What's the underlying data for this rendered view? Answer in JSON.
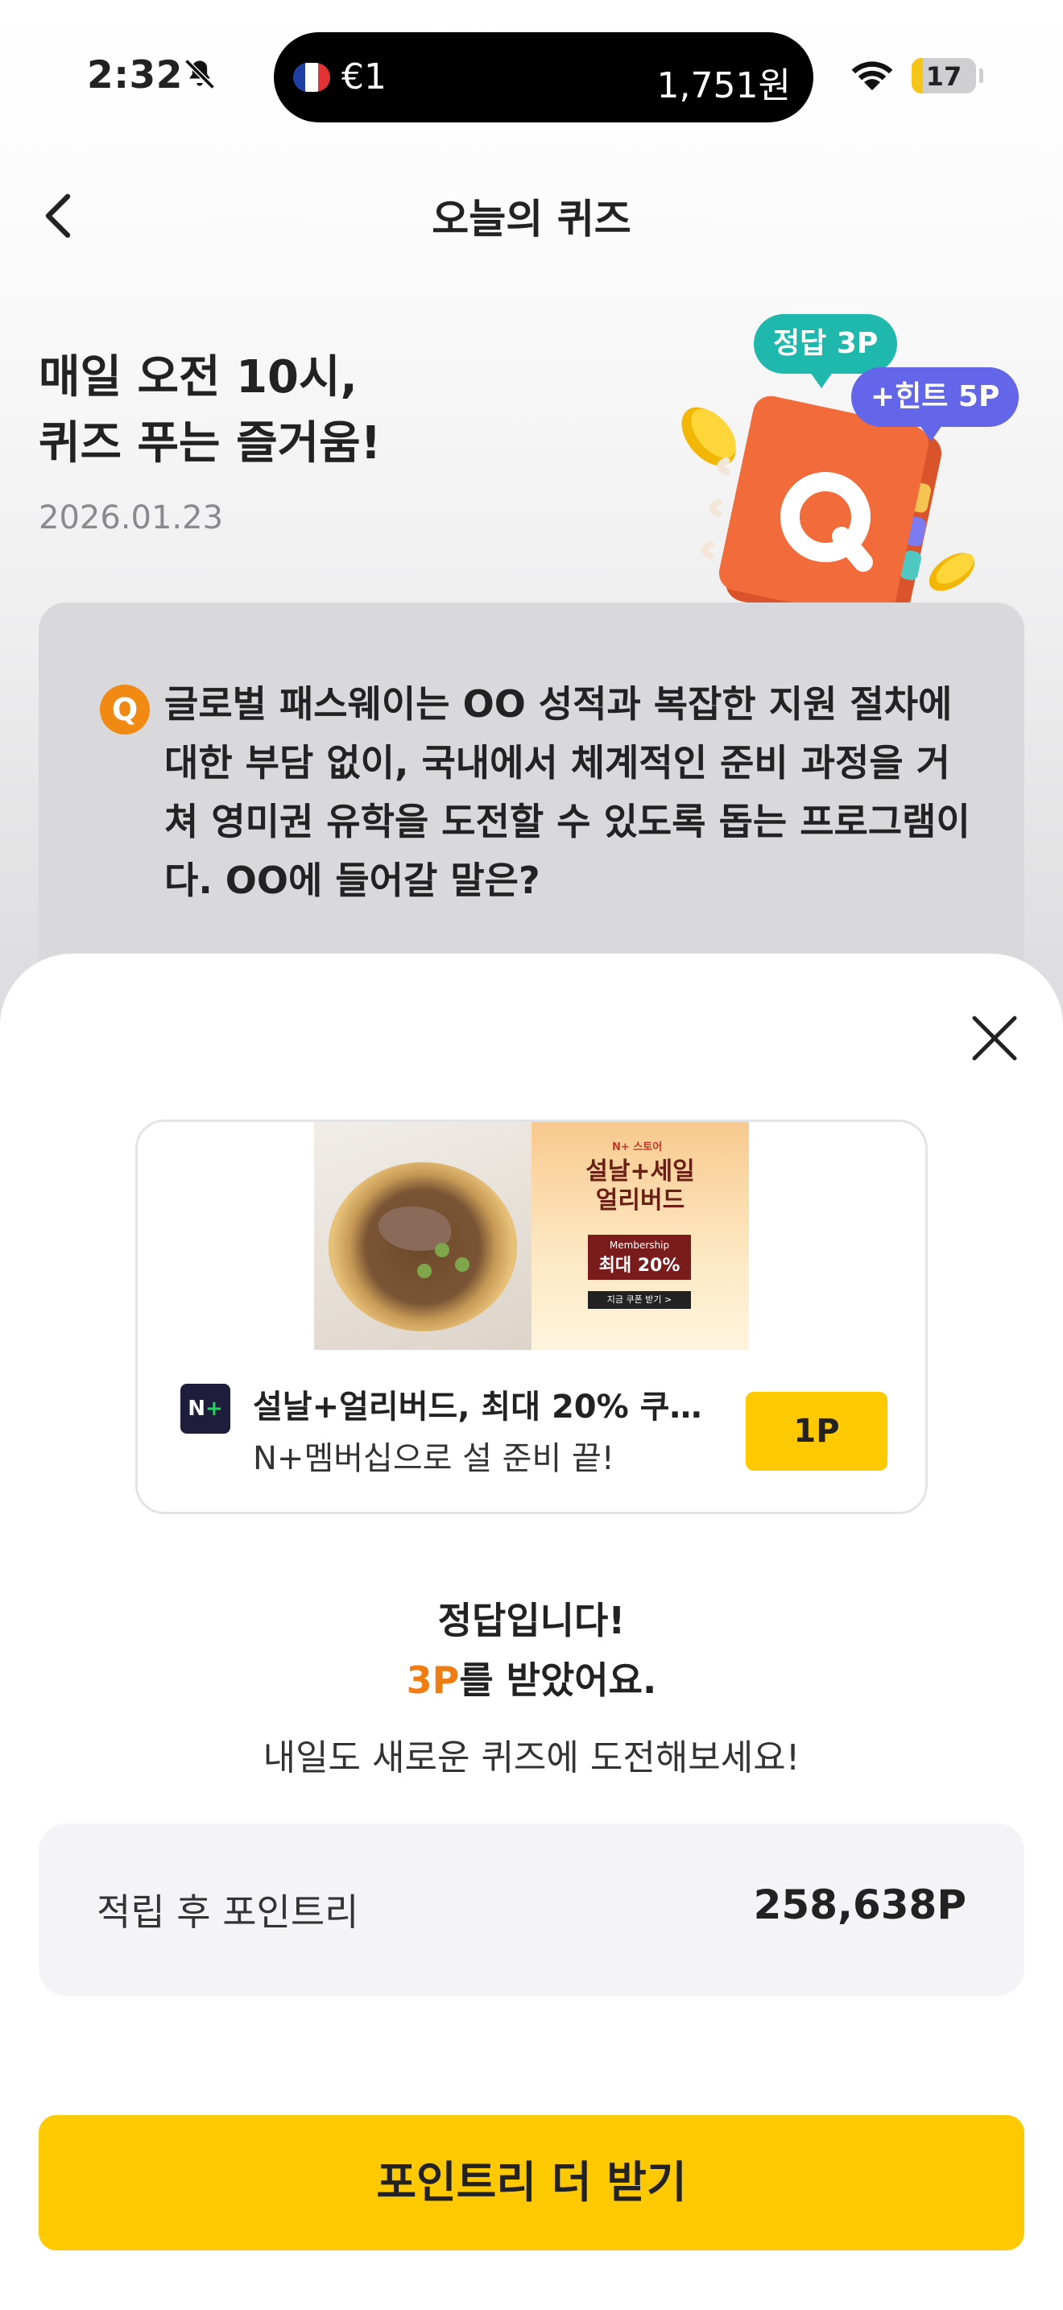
{
  "status_bar": {
    "time": "2:32",
    "island_left": "€1",
    "island_right": "1,751원",
    "battery": "17",
    "icons": [
      "bell-slash-icon",
      "france-flag-icon",
      "wifi-icon",
      "battery-icon"
    ]
  },
  "nav": {
    "title": "오늘의 퀴즈",
    "back_icon": "chevron-left-icon"
  },
  "hero": {
    "title_line1": "매일 오전 10시,",
    "title_line2": "퀴즈 푸는 즐거움!",
    "date": "2026.01.23",
    "bubble_answer": "정답 3P",
    "bubble_hint": "+힌트 5P",
    "notebook_letter": "Q"
  },
  "question": {
    "badge": "Q",
    "lines": [
      "글로벌 패스웨이는 OO 성적과 복잡한 지원 절차에",
      "대한 부담 없이, 국내에서 체계적인 준비 과정을 거",
      "쳐 영미권 유학을 도전할 수 있도록 돕는 프로그램이",
      "다. OO에 들어갈 말은?"
    ]
  },
  "ad": {
    "promo_tag": "N+ 스토어",
    "promo_title_1": "설날+세일",
    "promo_title_2": "얼리버드",
    "promo_box_small": "Membership",
    "promo_box_big": "최대 20%",
    "promo_button": "지금 쿠폰 받기 >",
    "logo_text": "N",
    "logo_plus": "+",
    "title": "설날+얼리버드, 최대 20% 쿠폰...",
    "subtitle": "N+멤버십으로 설 준비 끝!",
    "point_button": "1P"
  },
  "result": {
    "line1": "정답입니다!",
    "points_earned": "3P",
    "line2_suffix": "를 받았어요.",
    "line3": "내일도 새로운 퀴즈에 도전해보세요!"
  },
  "balance": {
    "label": "적립 후 포인트리",
    "value": "258,638P"
  },
  "cta": {
    "label": "포인트리 더 받기"
  },
  "colors": {
    "accent_yellow": "#ffc900",
    "orange": "#f07d12",
    "teal_bubble": "#1fb8ac",
    "purple_bubble": "#6366e8",
    "notebook": "#f26b3a"
  },
  "battery_level": 0.17
}
